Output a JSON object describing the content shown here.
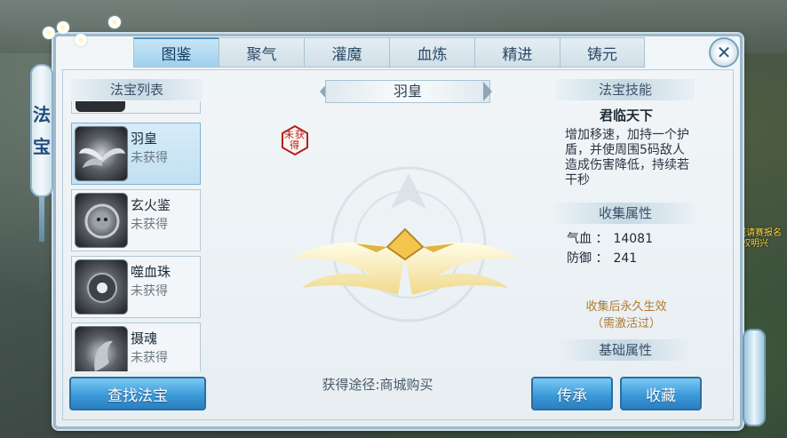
{
  "side_label": [
    "法",
    "宝"
  ],
  "tabs": [
    {
      "label": "图鉴",
      "active": true
    },
    {
      "label": "聚气",
      "active": false
    },
    {
      "label": "灌魔",
      "active": false
    },
    {
      "label": "血炼",
      "active": false
    },
    {
      "label": "精进",
      "active": false
    },
    {
      "label": "铸元",
      "active": false
    }
  ],
  "close_glyph": "✕",
  "list": {
    "title": "法宝列表",
    "items": [
      {
        "name": "羽皇",
        "status": "未获得",
        "selected": true,
        "icon": "wings-icon"
      },
      {
        "name": "玄火鉴",
        "status": "未获得",
        "selected": false,
        "icon": "fire-mirror-icon"
      },
      {
        "name": "噬血珠",
        "status": "未获得",
        "selected": false,
        "icon": "blood-orb-icon"
      },
      {
        "name": "摄魂",
        "status": "未获得",
        "selected": false,
        "icon": "soul-icon"
      }
    ],
    "find_button": "查找法宝"
  },
  "detail": {
    "name": "羽皇",
    "seal_text": "未获得",
    "source": "获得途径:商城购买"
  },
  "skill": {
    "header": "法宝技能",
    "name": "君临天下",
    "description": "增加移速，加持一个护盾，并使周围5码敌人造成伤害降低，持续若干秒"
  },
  "collect": {
    "header": "收集属性",
    "attrs": [
      {
        "label": "气血",
        "value": "14081"
      },
      {
        "label": "防御",
        "value": "241"
      }
    ],
    "note_1": "收集后永久生效",
    "note_2": "（需激活过）"
  },
  "base": {
    "header": "基础属性"
  },
  "buttons": {
    "inherit": "传承",
    "collect": "收藏"
  },
  "background_banner": "县城请赛报名权明兴",
  "colors": {
    "accent": "#3c9ad8",
    "seal_red": "#b3211c",
    "note_gold": "#b07a2a",
    "banner_yellow": "#ffd640"
  }
}
